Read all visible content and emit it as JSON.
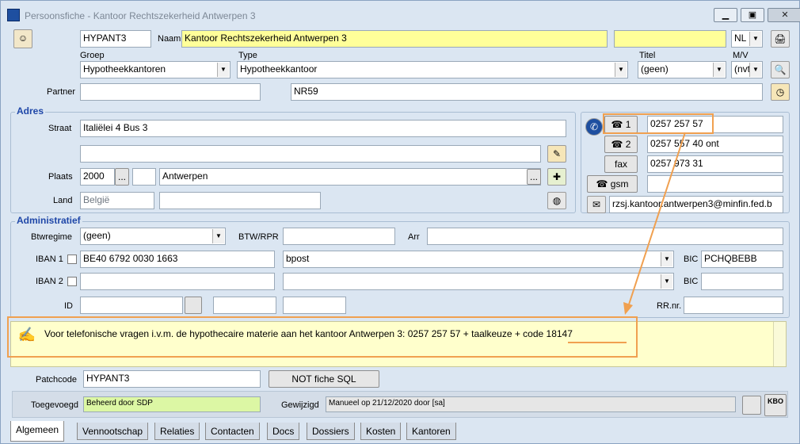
{
  "window": {
    "title": "Persoonsfiche - Kantoor Rechtszekerheid Antwerpen 3"
  },
  "header": {
    "code": "HYPANT3",
    "naam_label": "Naam",
    "naam_value": "Kantoor Rechtszekerheid Antwerpen 3",
    "lang": "NL",
    "groep_label": "Groep",
    "groep_value": "Hypotheekkantoren",
    "type_label": "Type",
    "type_value": "Hypotheekkantoor",
    "titel_label": "Titel",
    "titel_value": "(geen)",
    "mv_label": "M/V",
    "mv_value": "(nvt",
    "partner_label": "Partner",
    "partner_value": "",
    "ref_value": "NR59"
  },
  "adres": {
    "title": "Adres",
    "straat_label": "Straat",
    "straat_value": "Italiëlei 4 Bus 3",
    "straat2_value": "",
    "plaats_label": "Plaats",
    "postcode": "2000",
    "ellipsis": "...",
    "gemeente": "Antwerpen",
    "land_label": "Land",
    "land_value": "België"
  },
  "contact": {
    "tel1_label": "1",
    "tel1_value": "0257 257 57",
    "tel2_label": "2",
    "tel2_value": "0257 557 40 ont",
    "fax_label": "fax",
    "fax_value": "0257 973 31",
    "gsm_label": "gsm",
    "gsm_value": "",
    "email_value": "rzsj.kantoor.antwerpen3@minfin.fed.b"
  },
  "admin": {
    "title": "Administratief",
    "btw_regime_label": "Btwregime",
    "btw_regime_value": "(geen)",
    "btw_rpr_label": "BTW/RPR",
    "arr_label": "Arr",
    "iban1_label": "IBAN 1",
    "iban1_value": "BE40 6792 0030 1663",
    "bank1_value": "bpost",
    "bic_label": "BIC",
    "bic1_value": "PCHQBEBB",
    "iban2_label": "IBAN 2",
    "bic2_label": "BIC",
    "id_label": "ID",
    "rrnr_label": "RR.nr."
  },
  "note": {
    "text": "Voor telefonische vragen i.v.m. de hypothecaire materie aan het kantoor  Antwerpen 3:  0257 257 57 + taalkeuze + code   18147"
  },
  "footer": {
    "patchcode_label": "Patchcode",
    "patchcode_value": "HYPANT3",
    "sql_button": "NOT fiche SQL",
    "toegevoegd_label": "Toegevoegd",
    "toegevoegd_value": "Beheerd door SDP",
    "gewijzigd_label": "Gewijzigd",
    "gewijzigd_value": "Manueel op 21/12/2020 door [sa]",
    "kbo_label": "KBO"
  },
  "tabs": [
    "Algemeen",
    "Vennootschap",
    "Relaties",
    "Contacten",
    "Docs",
    "Dossiers",
    "Kosten",
    "Kantoren"
  ],
  "colors": {
    "accent_orange": "#f0a050",
    "yellow_field": "#ffff99",
    "group_title": "#1f47a8"
  }
}
